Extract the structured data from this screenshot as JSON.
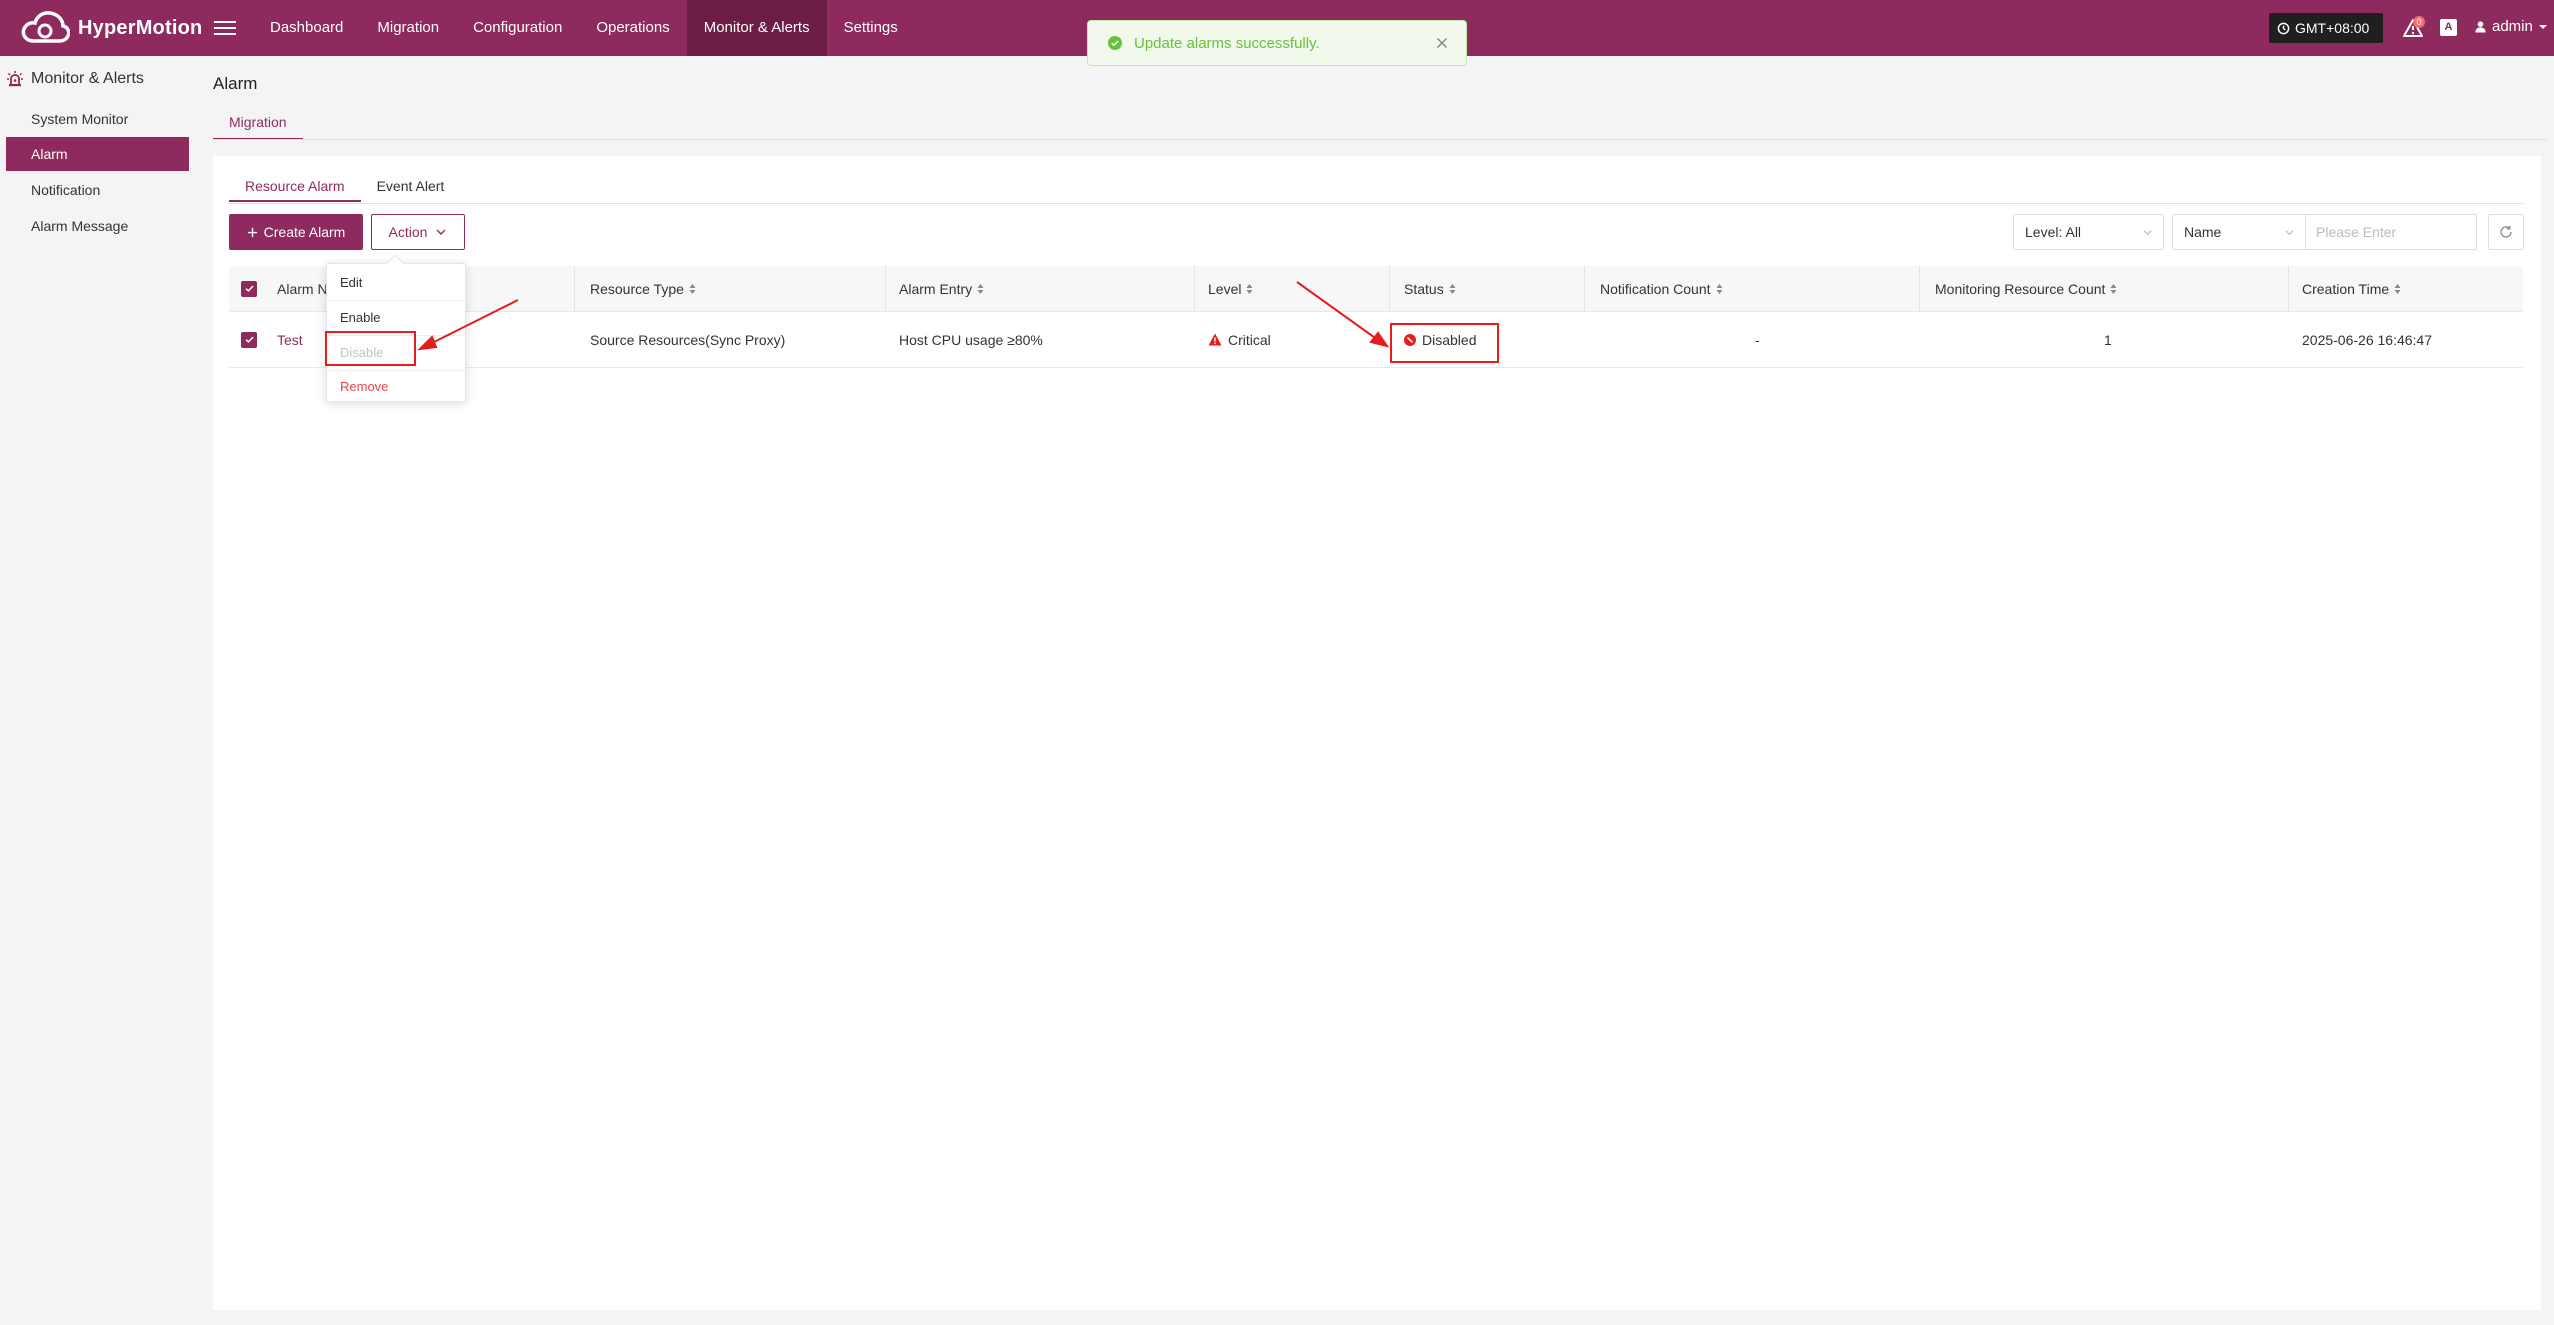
{
  "app": {
    "brand": "HyperMotion"
  },
  "nav": {
    "items": [
      {
        "label": "Dashboard"
      },
      {
        "label": "Migration"
      },
      {
        "label": "Configuration"
      },
      {
        "label": "Operations"
      },
      {
        "label": "Monitor & Alerts"
      },
      {
        "label": "Settings"
      }
    ],
    "active": "Monitor & Alerts"
  },
  "header": {
    "timezone": "GMT+08:00",
    "alert_count": "0",
    "lang_icon": "A",
    "user": "admin"
  },
  "toast": {
    "message": "Update alarms successfully."
  },
  "sidebar": {
    "section": "Monitor & Alerts",
    "items": [
      {
        "label": "System Monitor"
      },
      {
        "label": "Alarm"
      },
      {
        "label": "Notification"
      },
      {
        "label": "Alarm Message"
      }
    ],
    "active": "Alarm"
  },
  "page": {
    "title": "Alarm",
    "tab": "Migration",
    "subtabs": [
      {
        "label": "Resource Alarm"
      },
      {
        "label": "Event Alert"
      }
    ]
  },
  "toolbar": {
    "create_label": "Create Alarm",
    "action_label": "Action",
    "level_filter": "Level: All",
    "name_filter": "Name",
    "search_placeholder": "Please Enter"
  },
  "action_menu": {
    "items": [
      {
        "label": "Edit",
        "state": "enabled"
      },
      {
        "label": "Enable",
        "state": "enabled"
      },
      {
        "label": "Disable",
        "state": "disabled"
      },
      {
        "label": "Remove",
        "state": "danger"
      }
    ]
  },
  "table": {
    "columns": [
      "Alarm Name",
      "Resource Type",
      "Alarm Entry",
      "Level",
      "Status",
      "Notification Count",
      "Monitoring Resource Count",
      "Creation Time"
    ],
    "rows": [
      {
        "name": "Test",
        "resource_type": "Source Resources(Sync Proxy)",
        "alarm_entry": "Host CPU usage ≥80%",
        "level": "Critical",
        "status": "Disabled",
        "notification_count": "-",
        "monitoring_resource_count": "1",
        "creation_time": "2025-06-26 16:46:47"
      }
    ]
  },
  "colors": {
    "brand": "#8e2a5e",
    "active_nav": "#6d1c46",
    "success": "#67c23a",
    "danger": "#e84545",
    "annotation": "#e51d1d"
  }
}
